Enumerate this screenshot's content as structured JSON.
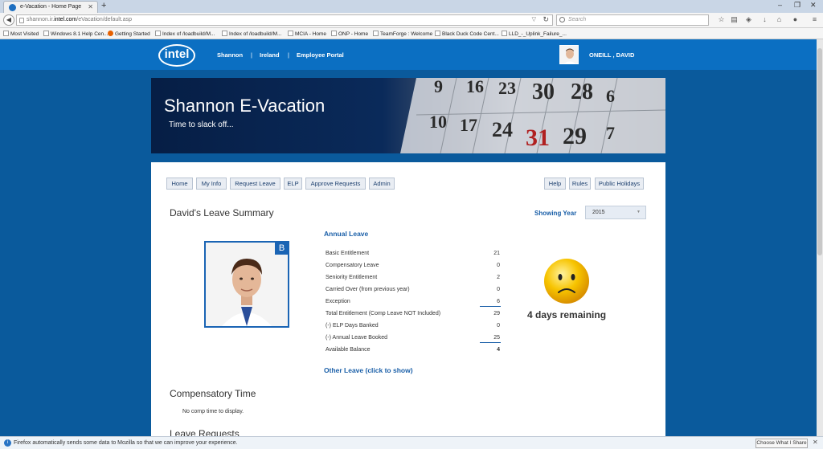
{
  "browser": {
    "tab_title": "e-Vacation - Home Page",
    "new_tab": "+",
    "url_prefix": "shannon.ir.",
    "url_domain": "intel.com",
    "url_path": "/eVacation/default.asp",
    "search_placeholder": "Search",
    "bookmarks": [
      "Most Visited",
      "Windows 8.1 Help Cen...",
      "Getting Started",
      "Index of /loadbuild/M...",
      "Index of /loadbuild/M...",
      "MCIA - Home",
      "ONP - Home",
      "TeamForge : Welcome",
      "Black Duck Code Cent...",
      "LLD_-_Uplink_Failure_..."
    ]
  },
  "site_header": {
    "logo": "intel",
    "links": [
      "Shannon",
      "Ireland",
      "Employee Portal"
    ],
    "separator": "|",
    "user_name": "ONEILL , DAVID"
  },
  "banner": {
    "title": "Shannon E-Vacation",
    "subtitle": "Time to slack off...",
    "calendar_numbers": [
      "9",
      "16",
      "23",
      "30",
      "28",
      "10",
      "17",
      "24",
      "31",
      "29",
      "6",
      "7"
    ]
  },
  "nav": {
    "left": [
      "Home",
      "My Info",
      "Request Leave",
      "ELP",
      "Approve Requests",
      "Admin"
    ],
    "right": [
      "Help",
      "Rules",
      "Public Holidays"
    ]
  },
  "summary": {
    "title": "David's Leave Summary",
    "showing_year_label": "Showing Year",
    "year": "2015",
    "photo_badge": "B",
    "annual_leave_title": "Annual Leave",
    "rows": [
      {
        "label": "Basic Entitlement",
        "value": "21"
      },
      {
        "label": "Compensatory Leave",
        "value": "0"
      },
      {
        "label": "Seniority Entitlement",
        "value": "2"
      },
      {
        "label": "Carried Over (from previous year)",
        "value": "0"
      },
      {
        "label": "Exception",
        "value": "6"
      },
      {
        "label": "Total Entitlement (Comp Leave NOT Included)",
        "value": "29"
      },
      {
        "label": "(-) ELP Days Banked",
        "value": "0"
      },
      {
        "label": "(-) Annual Leave Booked",
        "value": "25"
      },
      {
        "label": "Available Balance",
        "value": "4"
      }
    ],
    "other_leave": "Other Leave (click to show)",
    "days_remaining": "4 days remaining"
  },
  "comp_time": {
    "title": "Compensatory Time",
    "empty": "No comp time to display."
  },
  "leave_requests": {
    "title": "Leave Requests"
  },
  "notification": {
    "message": "Firefox automatically sends some data to Mozilla so that we can improve your experience.",
    "button": "Choose What I Share"
  }
}
